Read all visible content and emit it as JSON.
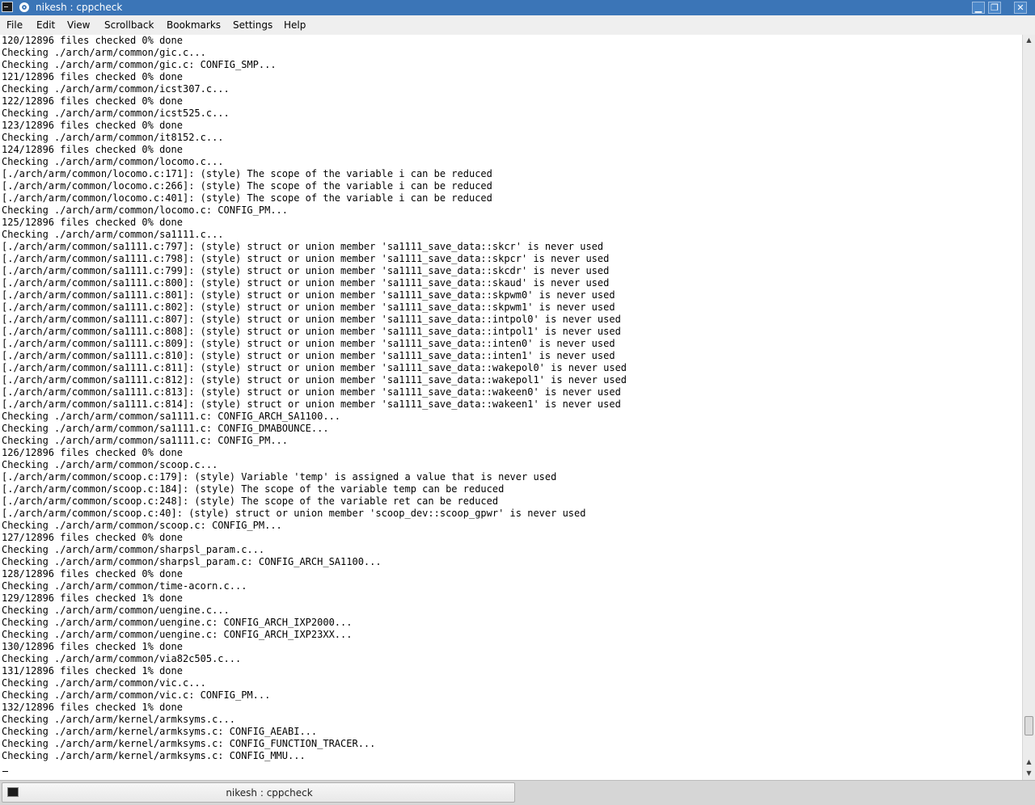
{
  "window": {
    "title": "nikesh : cppcheck"
  },
  "menu": [
    "File",
    "Edit",
    "View",
    "Scrollback",
    "Bookmarks",
    "Settings",
    "Help"
  ],
  "terminal": {
    "lines": [
      "120/12896 files checked 0% done",
      "Checking ./arch/arm/common/gic.c...",
      "Checking ./arch/arm/common/gic.c: CONFIG_SMP...",
      "121/12896 files checked 0% done",
      "Checking ./arch/arm/common/icst307.c...",
      "122/12896 files checked 0% done",
      "Checking ./arch/arm/common/icst525.c...",
      "123/12896 files checked 0% done",
      "Checking ./arch/arm/common/it8152.c...",
      "124/12896 files checked 0% done",
      "Checking ./arch/arm/common/locomo.c...",
      "[./arch/arm/common/locomo.c:171]: (style) The scope of the variable i can be reduced",
      "[./arch/arm/common/locomo.c:266]: (style) The scope of the variable i can be reduced",
      "[./arch/arm/common/locomo.c:401]: (style) The scope of the variable i can be reduced",
      "Checking ./arch/arm/common/locomo.c: CONFIG_PM...",
      "125/12896 files checked 0% done",
      "Checking ./arch/arm/common/sa1111.c...",
      "[./arch/arm/common/sa1111.c:797]: (style) struct or union member 'sa1111_save_data::skcr' is never used",
      "[./arch/arm/common/sa1111.c:798]: (style) struct or union member 'sa1111_save_data::skpcr' is never used",
      "[./arch/arm/common/sa1111.c:799]: (style) struct or union member 'sa1111_save_data::skcdr' is never used",
      "[./arch/arm/common/sa1111.c:800]: (style) struct or union member 'sa1111_save_data::skaud' is never used",
      "[./arch/arm/common/sa1111.c:801]: (style) struct or union member 'sa1111_save_data::skpwm0' is never used",
      "[./arch/arm/common/sa1111.c:802]: (style) struct or union member 'sa1111_save_data::skpwm1' is never used",
      "[./arch/arm/common/sa1111.c:807]: (style) struct or union member 'sa1111_save_data::intpol0' is never used",
      "[./arch/arm/common/sa1111.c:808]: (style) struct or union member 'sa1111_save_data::intpol1' is never used",
      "[./arch/arm/common/sa1111.c:809]: (style) struct or union member 'sa1111_save_data::inten0' is never used",
      "[./arch/arm/common/sa1111.c:810]: (style) struct or union member 'sa1111_save_data::inten1' is never used",
      "[./arch/arm/common/sa1111.c:811]: (style) struct or union member 'sa1111_save_data::wakepol0' is never used",
      "[./arch/arm/common/sa1111.c:812]: (style) struct or union member 'sa1111_save_data::wakepol1' is never used",
      "[./arch/arm/common/sa1111.c:813]: (style) struct or union member 'sa1111_save_data::wakeen0' is never used",
      "[./arch/arm/common/sa1111.c:814]: (style) struct or union member 'sa1111_save_data::wakeen1' is never used",
      "Checking ./arch/arm/common/sa1111.c: CONFIG_ARCH_SA1100...",
      "Checking ./arch/arm/common/sa1111.c: CONFIG_DMABOUNCE...",
      "Checking ./arch/arm/common/sa1111.c: CONFIG_PM...",
      "126/12896 files checked 0% done",
      "Checking ./arch/arm/common/scoop.c...",
      "[./arch/arm/common/scoop.c:179]: (style) Variable 'temp' is assigned a value that is never used",
      "[./arch/arm/common/scoop.c:184]: (style) The scope of the variable temp can be reduced",
      "[./arch/arm/common/scoop.c:248]: (style) The scope of the variable ret can be reduced",
      "[./arch/arm/common/scoop.c:40]: (style) struct or union member 'scoop_dev::scoop_gpwr' is never used",
      "Checking ./arch/arm/common/scoop.c: CONFIG_PM...",
      "127/12896 files checked 0% done",
      "Checking ./arch/arm/common/sharpsl_param.c...",
      "Checking ./arch/arm/common/sharpsl_param.c: CONFIG_ARCH_SA1100...",
      "128/12896 files checked 0% done",
      "Checking ./arch/arm/common/time-acorn.c...",
      "129/12896 files checked 1% done",
      "Checking ./arch/arm/common/uengine.c...",
      "Checking ./arch/arm/common/uengine.c: CONFIG_ARCH_IXP2000...",
      "Checking ./arch/arm/common/uengine.c: CONFIG_ARCH_IXP23XX...",
      "130/12896 files checked 1% done",
      "Checking ./arch/arm/common/via82c505.c...",
      "131/12896 files checked 1% done",
      "Checking ./arch/arm/common/vic.c...",
      "Checking ./arch/arm/common/vic.c: CONFIG_PM...",
      "132/12896 files checked 1% done",
      "Checking ./arch/arm/kernel/armksyms.c...",
      "Checking ./arch/arm/kernel/armksyms.c: CONFIG_AEABI...",
      "Checking ./arch/arm/kernel/armksyms.c: CONFIG_FUNCTION_TRACER...",
      "Checking ./arch/arm/kernel/armksyms.c: CONFIG_MMU..."
    ]
  },
  "scrollbar": {
    "position_fraction": 0.97
  },
  "taskbar": {
    "task_label": "nikesh : cppcheck"
  },
  "icons": {
    "app": "terminal-icon",
    "pin": "pin-icon",
    "minimize": "minimize-icon",
    "maximize": "maximize-icon",
    "close": "close-icon"
  },
  "colors": {
    "titlebar": "#3b75b7",
    "menubar": "#efefef",
    "terminal_bg": "#ffffff",
    "terminal_fg": "#000000"
  }
}
